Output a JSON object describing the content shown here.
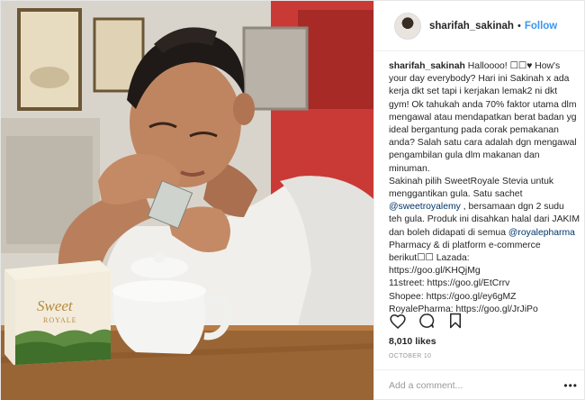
{
  "header": {
    "username": "sharifah_sakinah",
    "separator": "•",
    "follow_label": "Follow"
  },
  "caption": {
    "username": "sharifah_sakinah",
    "line1": "Halloooo! ☐☐♥ How's your day everybody? Hari ini Sakinah x ada kerja dkt set tapi i kerjakan lemak2 ni dkt gym! Ok tahukah anda 70% faktor utama dlm mengawal atau mendapatkan berat badan yg ideal bergantung pada corak pemakanan anda? Salah satu cara adalah dgn mengawal pengambilan gula dlm makanan dan minuman.",
    "line2": "Sakinah pilih SweetRoyale Stevia untuk menggantikan gula. Satu sachet",
    "mention1": "@sweetroyalemy",
    "line3": ", bersamaan dgn 2 sudu teh gula. Produk ini disahkan halal dari JAKIM dan boleh didapati di semua",
    "mention2": "@royalepharma",
    "line4": "Pharmacy & di platform e-commerce berikut☐☐ Lazada:",
    "link_lazada": "https://goo.gl/KHQjMg",
    "link_11street": "11street: https://goo.gl/EtCrrv",
    "link_shopee": "Shopee: https://goo.gl/ey6gMZ",
    "link_royalepharma": "RoyalePharma: https://goo.gl/JrJiPo"
  },
  "actions": {
    "like_icon": "heart-icon",
    "comment_icon": "comment-icon",
    "save_icon": "bookmark-icon"
  },
  "likes_text": "8,010 likes",
  "date_text": "OCTOBER 10",
  "comment_placeholder": "Add a comment...",
  "more_label": "•••",
  "photo": {
    "box_brand_line1": "Sweet",
    "box_brand_line2": "ROYALE"
  },
  "colors": {
    "follow": "#3897f0",
    "mention": "#003569",
    "date": "#999999"
  }
}
